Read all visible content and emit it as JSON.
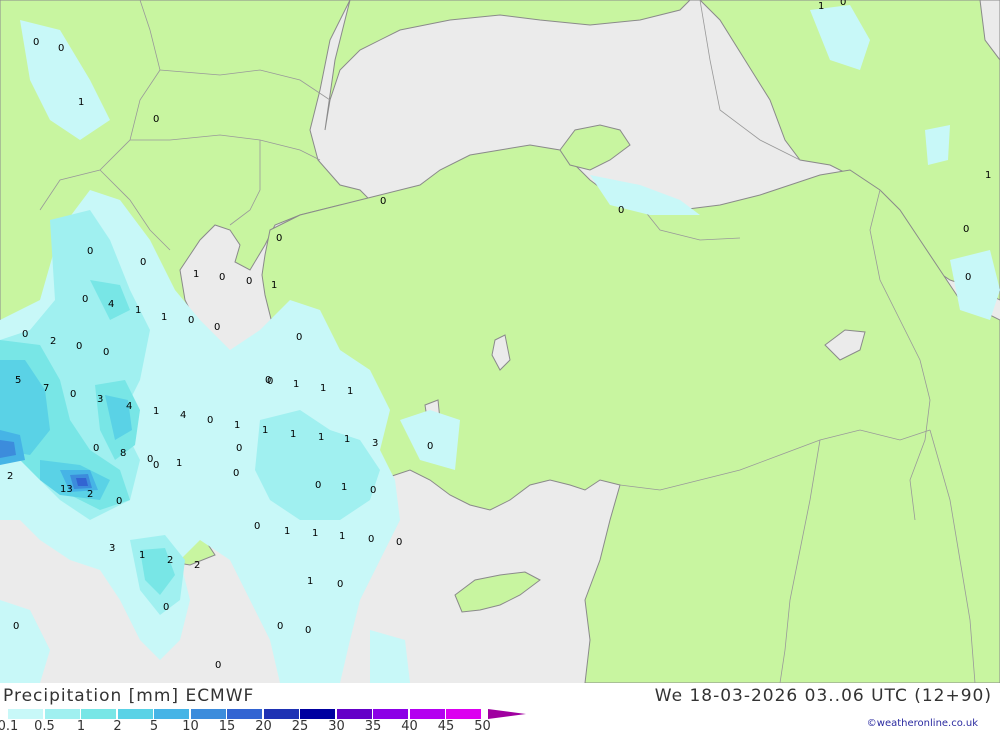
{
  "map": {
    "colors": {
      "sea": "#ebebeb",
      "land": "#c8f5a0",
      "border": "#999999",
      "coast": "#8a8a8a"
    },
    "precip_labels": [
      "0",
      "0",
      "1",
      "0",
      "0",
      "1",
      "0",
      "0",
      "0",
      "1",
      "0",
      "0",
      "0",
      "4",
      "1",
      "1",
      "0",
      "0",
      "0",
      "0",
      "2",
      "0",
      "0",
      "5",
      "7",
      "0",
      "3",
      "4",
      "1",
      "4",
      "0",
      "1",
      "1",
      "1",
      "1",
      "1",
      "8",
      "0",
      "1",
      "0",
      "0",
      "1",
      "1",
      "1",
      "3",
      "0",
      "1",
      "2",
      "13",
      "2",
      "0",
      "0",
      "1",
      "1",
      "1",
      "0",
      "0",
      "0",
      "3",
      "1",
      "2",
      "2",
      "1",
      "0",
      "0",
      "0",
      "0",
      "0",
      "0",
      "0",
      "0",
      "0",
      "1",
      "1",
      "0",
      "0",
      "0",
      "0",
      "0",
      "0"
    ],
    "legend": {
      "title": "Precipitation [mm] ECMWF",
      "values": [
        "0.1",
        "0.5",
        "1",
        "2",
        "5",
        "10",
        "15",
        "20",
        "25",
        "30",
        "35",
        "40",
        "45",
        "50"
      ],
      "colors": [
        "#c8f8f8",
        "#a0f0f0",
        "#78e6e6",
        "#5ad2e6",
        "#46b4e6",
        "#3c8cdc",
        "#3264d2",
        "#1e32b4",
        "#0000a0",
        "#6400c8",
        "#8c00e6",
        "#b400f0",
        "#dc00f0",
        "#a000a0"
      ]
    },
    "date_text": "We 18-03-2026 03..06 UTC (12+90)",
    "credit": "©weatheronline.co.uk"
  }
}
